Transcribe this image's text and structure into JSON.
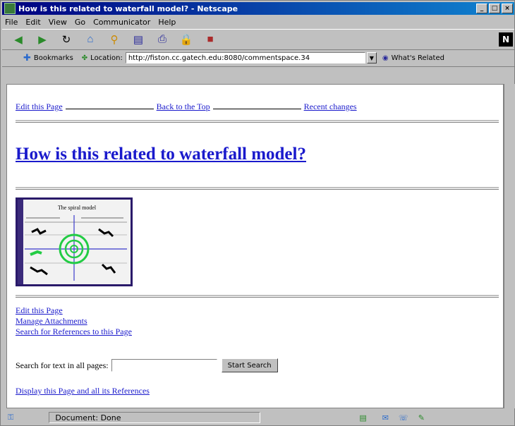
{
  "window": {
    "title": "How is this related to waterfall model? - Netscape"
  },
  "menu": [
    "File",
    "Edit",
    "View",
    "Go",
    "Communicator",
    "Help"
  ],
  "locbar": {
    "bookmarks": "Bookmarks",
    "location_label": "Location:",
    "url": "http://fiston.cc.gatech.edu:8080/commentspace.34",
    "whats_related": "What's Related"
  },
  "page": {
    "top_links": [
      "Edit this Page",
      "Back to the Top",
      "Recent changes"
    ],
    "title": "How is this related to waterfall model?",
    "figure_title": "The spiral model",
    "bottom_links": [
      "Edit this Page",
      "Manage Attachments",
      "Search for References to this Page"
    ],
    "search_label": "Search for text in all pages:",
    "search_button": "Start Search",
    "display_link": "Display this Page and all its References"
  },
  "status": {
    "text": "Document: Done"
  }
}
